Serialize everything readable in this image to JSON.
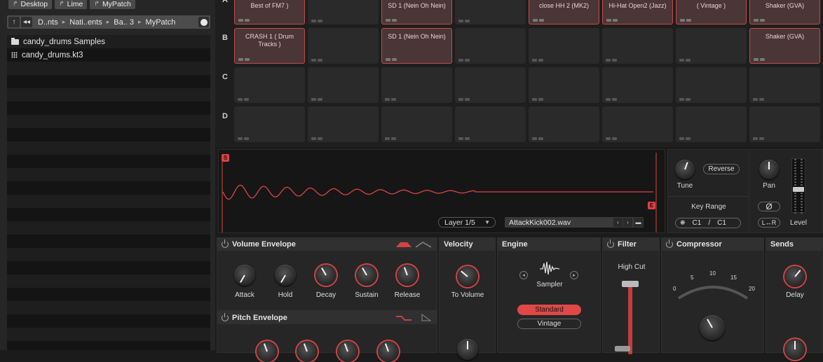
{
  "browser": {
    "favorites": [
      "Desktop",
      "Lime",
      "MyPatch"
    ],
    "path": [
      "D..nts",
      "Nati..ents",
      "Ba.. 3",
      "MyPatch"
    ],
    "items": [
      {
        "label": "candy_drums Samples",
        "type": "folder"
      },
      {
        "label": "candy_drums.kt3",
        "type": "kit"
      }
    ]
  },
  "pads": {
    "rows": [
      "A",
      "B",
      "C",
      "D"
    ],
    "A": [
      "Best of FM7 )",
      "",
      "SD 1 (Nein Oh Nein)",
      "",
      "close HH 2 (MK2)",
      "Hi-Hat Open2 (Jazz)",
      "( Vintage )",
      "Shaker (GVA)"
    ],
    "B": [
      "CRASH 1 ( Drum Tracks )",
      "",
      "SD 1 (Nein Oh Nein)",
      "",
      "",
      "",
      "",
      "Shaker (GVA)"
    ]
  },
  "wave": {
    "start_marker": "S",
    "end_marker": "E",
    "layer": "Layer 1/5",
    "file": "AttackKick002.wav"
  },
  "tune": {
    "knob_label": "Tune",
    "reverse_label": "Reverse",
    "key_range_label": "Key Range",
    "key_low": "C1",
    "key_sep": "/",
    "key_high": "C1"
  },
  "pan": {
    "knob_label": "Pan",
    "phase_label": "Ø",
    "stereo_label": "L↔R",
    "level_label": "Level"
  },
  "volume_envelope": {
    "title": "Volume Envelope",
    "knobs": [
      "Attack",
      "Hold",
      "Decay",
      "Sustain",
      "Release"
    ]
  },
  "pitch_envelope": {
    "title": "Pitch Envelope"
  },
  "velocity": {
    "title": "Velocity",
    "knob": "To Volume"
  },
  "engine": {
    "title": "Engine",
    "mode": "Sampler",
    "options": [
      "Standard",
      "Vintage"
    ],
    "selected": "Standard"
  },
  "filter": {
    "title": "Filter",
    "type": "High Cut"
  },
  "compressor": {
    "title": "Compressor",
    "scale": [
      "0",
      "5",
      "10",
      "15",
      "20"
    ]
  },
  "sends": {
    "title": "Sends",
    "knob": "Delay"
  },
  "colors": {
    "accent": "#d24444",
    "pad_active": "#4a3636",
    "bg": "#1b1b1b"
  }
}
